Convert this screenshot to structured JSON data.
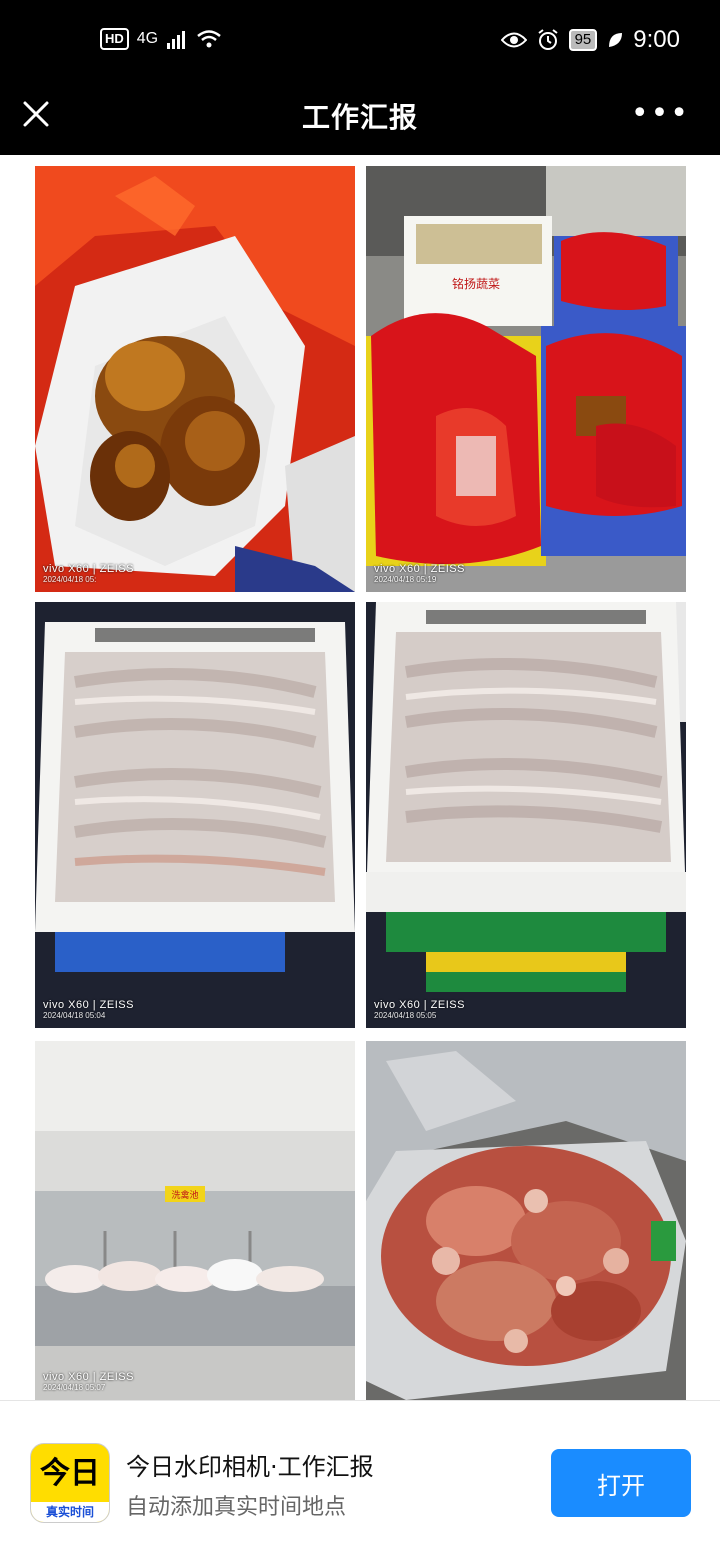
{
  "status_bar": {
    "hd": "HD",
    "network": "4G",
    "battery": "95",
    "time": "9:00"
  },
  "navbar": {
    "title": "工作汇报",
    "more": "•••"
  },
  "photos": [
    {
      "brand": "vivo X60 | ZEISS",
      "timestamp": "2024/04/18 05:"
    },
    {
      "brand": "vivo X60 | ZEISS",
      "timestamp": "2024/04/18 05:19"
    },
    {
      "brand": "vivo X60 | ZEISS",
      "timestamp": "2024/04/18 05:04"
    },
    {
      "brand": "vivo X60 | ZEISS",
      "timestamp": "2024/04/18 05:05"
    },
    {
      "brand": "vivo X60 | ZEISS",
      "timestamp": "2024/04/18 05:07"
    },
    {
      "brand": "",
      "timestamp": ""
    }
  ],
  "crate_label": "铭扬蔬菜",
  "sink_sign": "洗禽池",
  "banner": {
    "app_icon_top": "今日",
    "app_icon_bottom": "真实时间",
    "app_name": "今日水印相机·工作汇报",
    "app_desc": "自动添加真实时间地点",
    "open_label": "打开"
  },
  "colors": {
    "accent": "#1a8cff",
    "icon_bg": "#ffdd00"
  }
}
